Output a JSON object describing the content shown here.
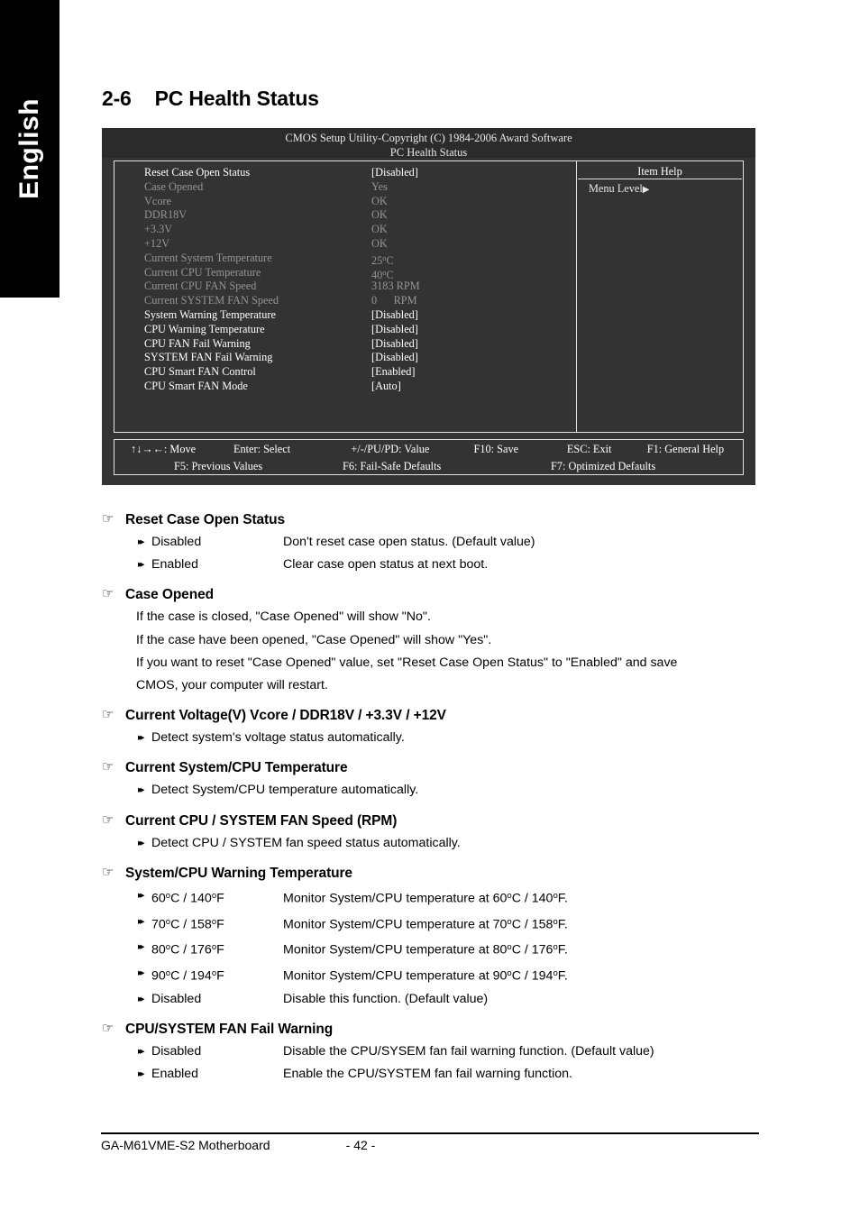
{
  "sidebar": {
    "language_label": "English"
  },
  "page_title": {
    "number": "2-6",
    "text": "PC Health Status"
  },
  "bios": {
    "header_line1": "CMOS Setup Utility-Copyright (C) 1984-2006 Award Software",
    "header_line2": "PC Health Status",
    "rows": [
      {
        "label": "Reset Case Open Status",
        "value": "[Disabled]",
        "state": "active"
      },
      {
        "label": "Case Opened",
        "value": "Yes",
        "state": "readonly"
      },
      {
        "label": "Vcore",
        "value": "OK",
        "state": "readonly"
      },
      {
        "label": "DDR18V",
        "value": "OK",
        "state": "readonly"
      },
      {
        "label": "+3.3V",
        "value": "OK",
        "state": "readonly"
      },
      {
        "label": "+12V",
        "value": "OK",
        "state": "readonly"
      },
      {
        "label": "Current System Temperature",
        "value": "25oC",
        "state": "readonly"
      },
      {
        "label": "Current CPU Temperature",
        "value": "40oC",
        "state": "readonly"
      },
      {
        "label": "Current CPU FAN Speed",
        "value": "3183 RPM",
        "state": "readonly"
      },
      {
        "label": "Current SYSTEM FAN Speed",
        "value": "0      RPM",
        "state": "readonly"
      },
      {
        "label": "System Warning Temperature",
        "value": "[Disabled]",
        "state": "active"
      },
      {
        "label": "CPU Warning Temperature",
        "value": "[Disabled]",
        "state": "active"
      },
      {
        "label": "CPU FAN Fail Warning",
        "value": "[Disabled]",
        "state": "active"
      },
      {
        "label": "SYSTEM FAN Fail Warning",
        "value": "[Disabled]",
        "state": "active"
      },
      {
        "label": "CPU Smart FAN Control",
        "value": "[Enabled]",
        "state": "active"
      },
      {
        "label": "CPU Smart FAN Mode",
        "value": "[Auto]",
        "state": "active"
      }
    ],
    "help": {
      "title": "Item Help",
      "menu_level": "Menu Level",
      "menu_level_arrow": "▶"
    },
    "footer": {
      "row1": [
        "↑↓→←: Move",
        "Enter: Select",
        "+/-/PU/PD: Value",
        "F10: Save",
        "ESC: Exit",
        "F1: General Help"
      ],
      "row2": [
        "F5: Previous Values",
        "F6: Fail-Safe Defaults",
        "F7: Optimized Defaults"
      ]
    }
  },
  "sections": [
    {
      "title": "Reset Case Open Status",
      "options": [
        {
          "name": "Disabled",
          "desc": "Don't reset case open status. (Default value)"
        },
        {
          "name": "Enabled",
          "desc": "Clear case open status at next boot."
        }
      ],
      "notes": []
    },
    {
      "title": "Case Opened",
      "options": [],
      "notes": [
        "If the case is closed, \"Case Opened\" will show \"No\".",
        "If the case have been opened, \"Case Opened\" will show \"Yes\".",
        "If you want to reset \"Case Opened\" value, set \"Reset Case Open Status\" to \"Enabled\" and save",
        "CMOS, your computer will restart."
      ]
    },
    {
      "title": "Current Voltage(V) Vcore / DDR18V / +3.3V / +12V",
      "options": [
        {
          "name": "",
          "desc": "Detect system's voltage status automatically."
        }
      ],
      "notes": []
    },
    {
      "title": "Current System/CPU Temperature",
      "options": [
        {
          "name": "",
          "desc": "Detect System/CPU temperature automatically."
        }
      ],
      "notes": []
    },
    {
      "title": "Current CPU / SYSTEM FAN Speed (RPM)",
      "options": [
        {
          "name": "",
          "desc": "Detect CPU / SYSTEM fan speed status automatically."
        }
      ],
      "notes": []
    },
    {
      "title": "System/CPU Warning Temperature",
      "options": [
        {
          "name": "60oC / 140oF",
          "desc": "Monitor System/CPU temperature at 60oC / 140oF."
        },
        {
          "name": "70oC / 158oF",
          "desc": "Monitor System/CPU temperature at 70oC / 158oF."
        },
        {
          "name": "80oC / 176oF",
          "desc": "Monitor System/CPU temperature at 80oC / 176oF."
        },
        {
          "name": "90oC / 194oF",
          "desc": "Monitor System/CPU temperature at 90oC / 194oF."
        },
        {
          "name": "Disabled",
          "desc": "Disable this function. (Default value)"
        }
      ],
      "notes": []
    },
    {
      "title": "CPU/SYSTEM FAN Fail Warning",
      "options": [
        {
          "name": "Disabled",
          "desc": "Disable the CPU/SYSEM fan fail warning function. (Default value)"
        },
        {
          "name": "Enabled",
          "desc": "Enable the CPU/SYSTEM fan fail warning function."
        }
      ],
      "notes": []
    }
  ],
  "footer": {
    "motherboard": "GA-M61VME-S2 Motherboard",
    "page_number": "- 42 -"
  },
  "icons": {
    "hand_pointer": "☞",
    "double_arrow": "▸▸"
  },
  "colors": {
    "bios_background": "#333333",
    "bios_header_background": "#2b2b2b",
    "bios_active_text": "#ffffff",
    "bios_readonly_text": "#959595",
    "sidebar_background": "#000000",
    "page_background": "#ffffff"
  }
}
